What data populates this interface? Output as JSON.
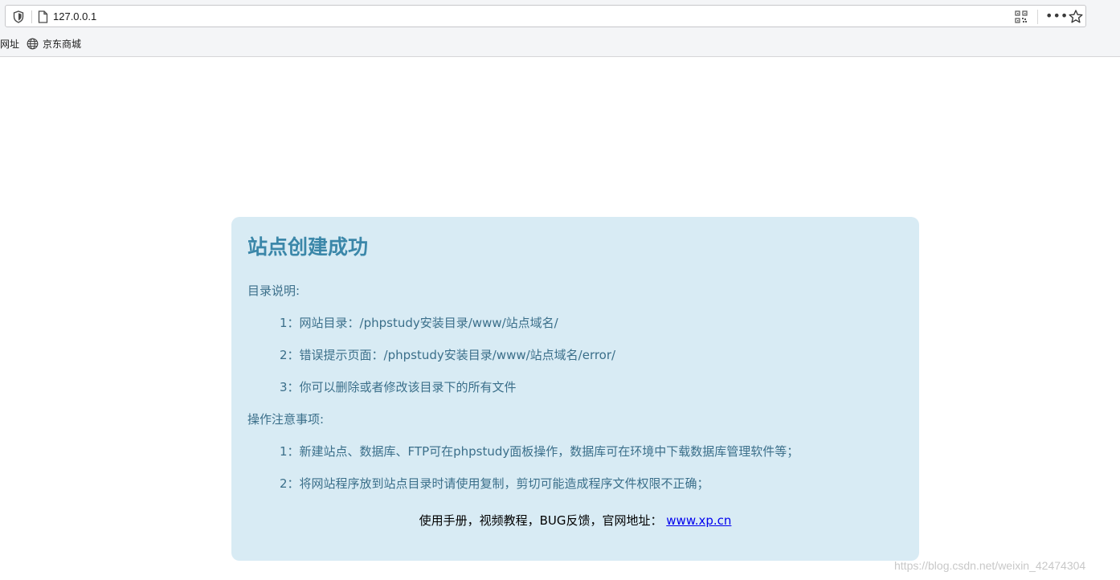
{
  "browser": {
    "url": "127.0.0.1",
    "more_glyph": "•••",
    "bookmarks": [
      {
        "label": "网址"
      },
      {
        "label": "京东商城"
      }
    ]
  },
  "page": {
    "title": "站点创建成功",
    "dir_heading": "目录说明:",
    "dir_items": [
      "1：网站目录：/phpstudy安装目录/www/站点域名/",
      "2：错误提示页面：/phpstudy安装目录/www/站点域名/error/",
      "3：你可以删除或者修改该目录下的所有文件"
    ],
    "notes_heading": "操作注意事项:",
    "notes_items": [
      "1：新建站点、数据库、FTP可在phpstudy面板操作，数据库可在环境中下载数据库管理软件等；",
      "2：将网站程序放到站点目录时请使用复制，剪切可能造成程序文件权限不正确；"
    ],
    "footer_text": "使用手册，视频教程，BUG反馈，官网地址：",
    "footer_link": "www.xp.cn"
  },
  "watermark": "https://blog.csdn.net/weixin_42474304",
  "colors": {
    "card_bg": "#d8ebf4",
    "title": "#3b87a9",
    "text": "#3b6f8a",
    "link": "#0000ee"
  }
}
